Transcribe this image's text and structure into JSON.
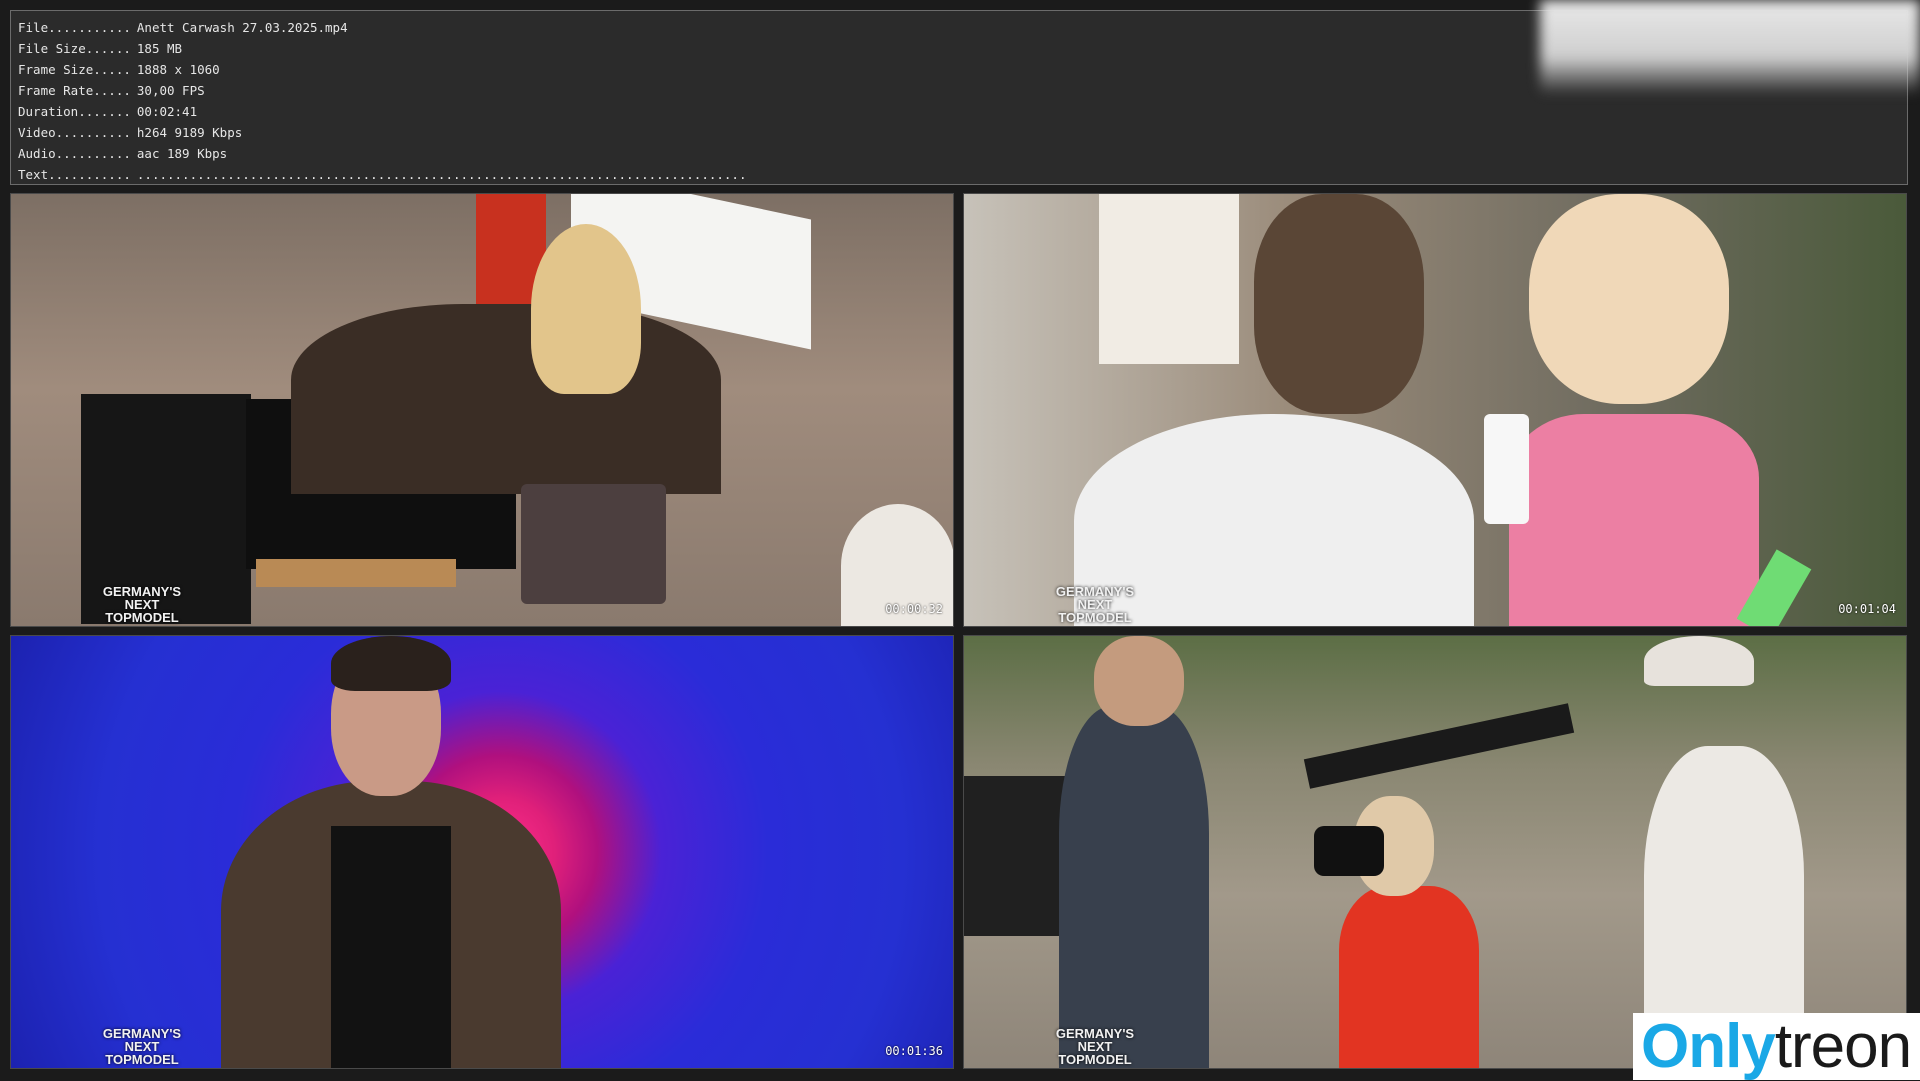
{
  "info": [
    {
      "key": "File...........",
      "value": "Anett Carwash 27.03.2025.mp4"
    },
    {
      "key": "File Size......",
      "value": "185 MB"
    },
    {
      "key": "Frame Size.....",
      "value": "1888 x 1060"
    },
    {
      "key": "Frame Rate.....",
      "value": "30,00 FPS"
    },
    {
      "key": "Duration.......",
      "value": "00:02:41"
    },
    {
      "key": "Video..........",
      "value": "h264 9189 Kbps"
    },
    {
      "key": "Audio..........",
      "value": "aac 189 Kbps"
    },
    {
      "key": "Text...........",
      "value": "................................................................................."
    }
  ],
  "thumbnails": [
    {
      "timecode": "00:00:32",
      "badge": [
        "GERMANY'S",
        "NEXT",
        "TOPMODEL"
      ]
    },
    {
      "timecode": "00:01:04",
      "badge": [
        "GERMANY'S",
        "NEXT",
        "TOPMODEL"
      ]
    },
    {
      "timecode": "00:01:36",
      "badge": [
        "GERMANY'S",
        "NEXT",
        "TOPMODEL"
      ]
    },
    {
      "timecode": "",
      "badge": [
        "GERMANY'S",
        "NEXT",
        "TOPMODEL"
      ]
    }
  ],
  "watermark": {
    "part1": "Only",
    "part2": "treon"
  },
  "colors": {
    "panel_bg": "#2b2b2b",
    "panel_text": "#e6e6e6",
    "watermark_blue": "#1aa8e6"
  }
}
